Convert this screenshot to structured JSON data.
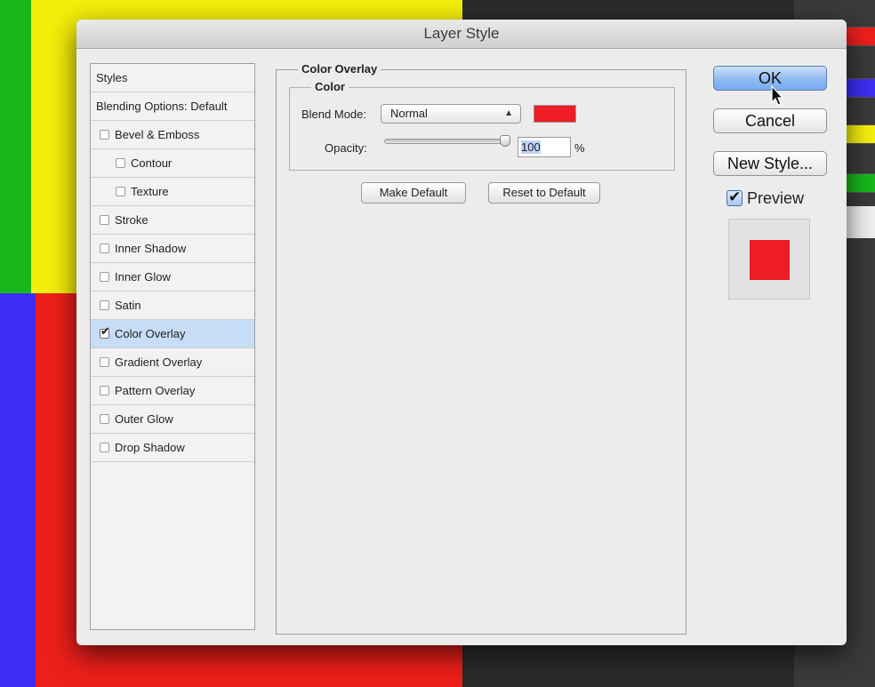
{
  "dialog": {
    "title": "Layer Style"
  },
  "colors": {
    "overlay": "#ee1c24",
    "yellow": "#f4ee0b",
    "green": "#1ab71a",
    "red": "#ec1f1a",
    "blue": "#3e2ef6"
  },
  "styles_panel": {
    "header": "Styles",
    "blending": "Blending Options: Default",
    "items": [
      {
        "label": "Bevel & Emboss",
        "checked": false
      },
      {
        "label": "Contour",
        "checked": false
      },
      {
        "label": "Texture",
        "checked": false
      },
      {
        "label": "Stroke",
        "checked": false
      },
      {
        "label": "Inner Shadow",
        "checked": false
      },
      {
        "label": "Inner Glow",
        "checked": false
      },
      {
        "label": "Satin",
        "checked": false
      },
      {
        "label": "Color Overlay",
        "checked": true
      },
      {
        "label": "Gradient Overlay",
        "checked": false
      },
      {
        "label": "Pattern Overlay",
        "checked": false
      },
      {
        "label": "Outer Glow",
        "checked": false
      },
      {
        "label": "Drop Shadow",
        "checked": false
      }
    ]
  },
  "color_overlay": {
    "group_title": "Color Overlay",
    "sub_title": "Color",
    "blend_label": "Blend Mode:",
    "blend_value": "Normal",
    "opacity_label": "Opacity:",
    "opacity_value": "100",
    "opacity_unit": "%",
    "opacity_level": 1.0,
    "make_default": "Make Default",
    "reset_default": "Reset to Default"
  },
  "buttons": {
    "ok": "OK",
    "cancel": "Cancel",
    "new_style": "New Style..."
  },
  "preview": {
    "label": "Preview",
    "checked": true
  }
}
